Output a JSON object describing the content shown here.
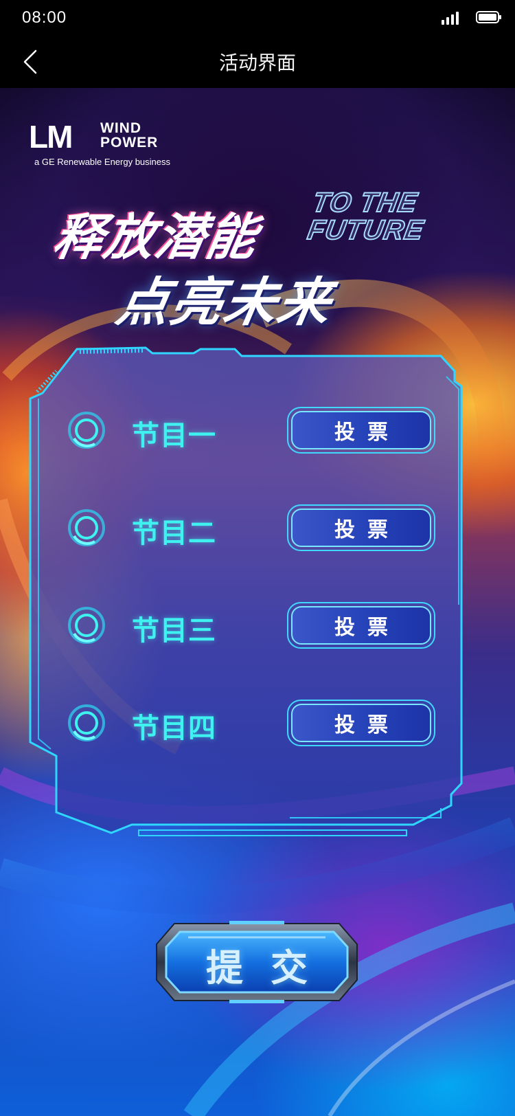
{
  "status_bar": {
    "time": "08:00"
  },
  "nav": {
    "title": "活动界面"
  },
  "brand": {
    "lm": "LM",
    "wind": "WIND",
    "power": "POWER",
    "tagline": "a GE Renewable Energy business"
  },
  "headline": {
    "line1": "释放潜能",
    "line2": "点亮未来",
    "en_line1": "TO THE",
    "en_line2": "FUTURE"
  },
  "programs": [
    {
      "name": "节目一",
      "vote_label": "投票"
    },
    {
      "name": "节目二",
      "vote_label": "投票"
    },
    {
      "name": "节目三",
      "vote_label": "投票"
    },
    {
      "name": "节目四",
      "vote_label": "投票"
    }
  ],
  "submit": {
    "label": "提交"
  },
  "colors": {
    "accent_cyan": "#3ff2f0",
    "button_blue": "#2542b8",
    "panel_border": "#2fd6ff"
  }
}
